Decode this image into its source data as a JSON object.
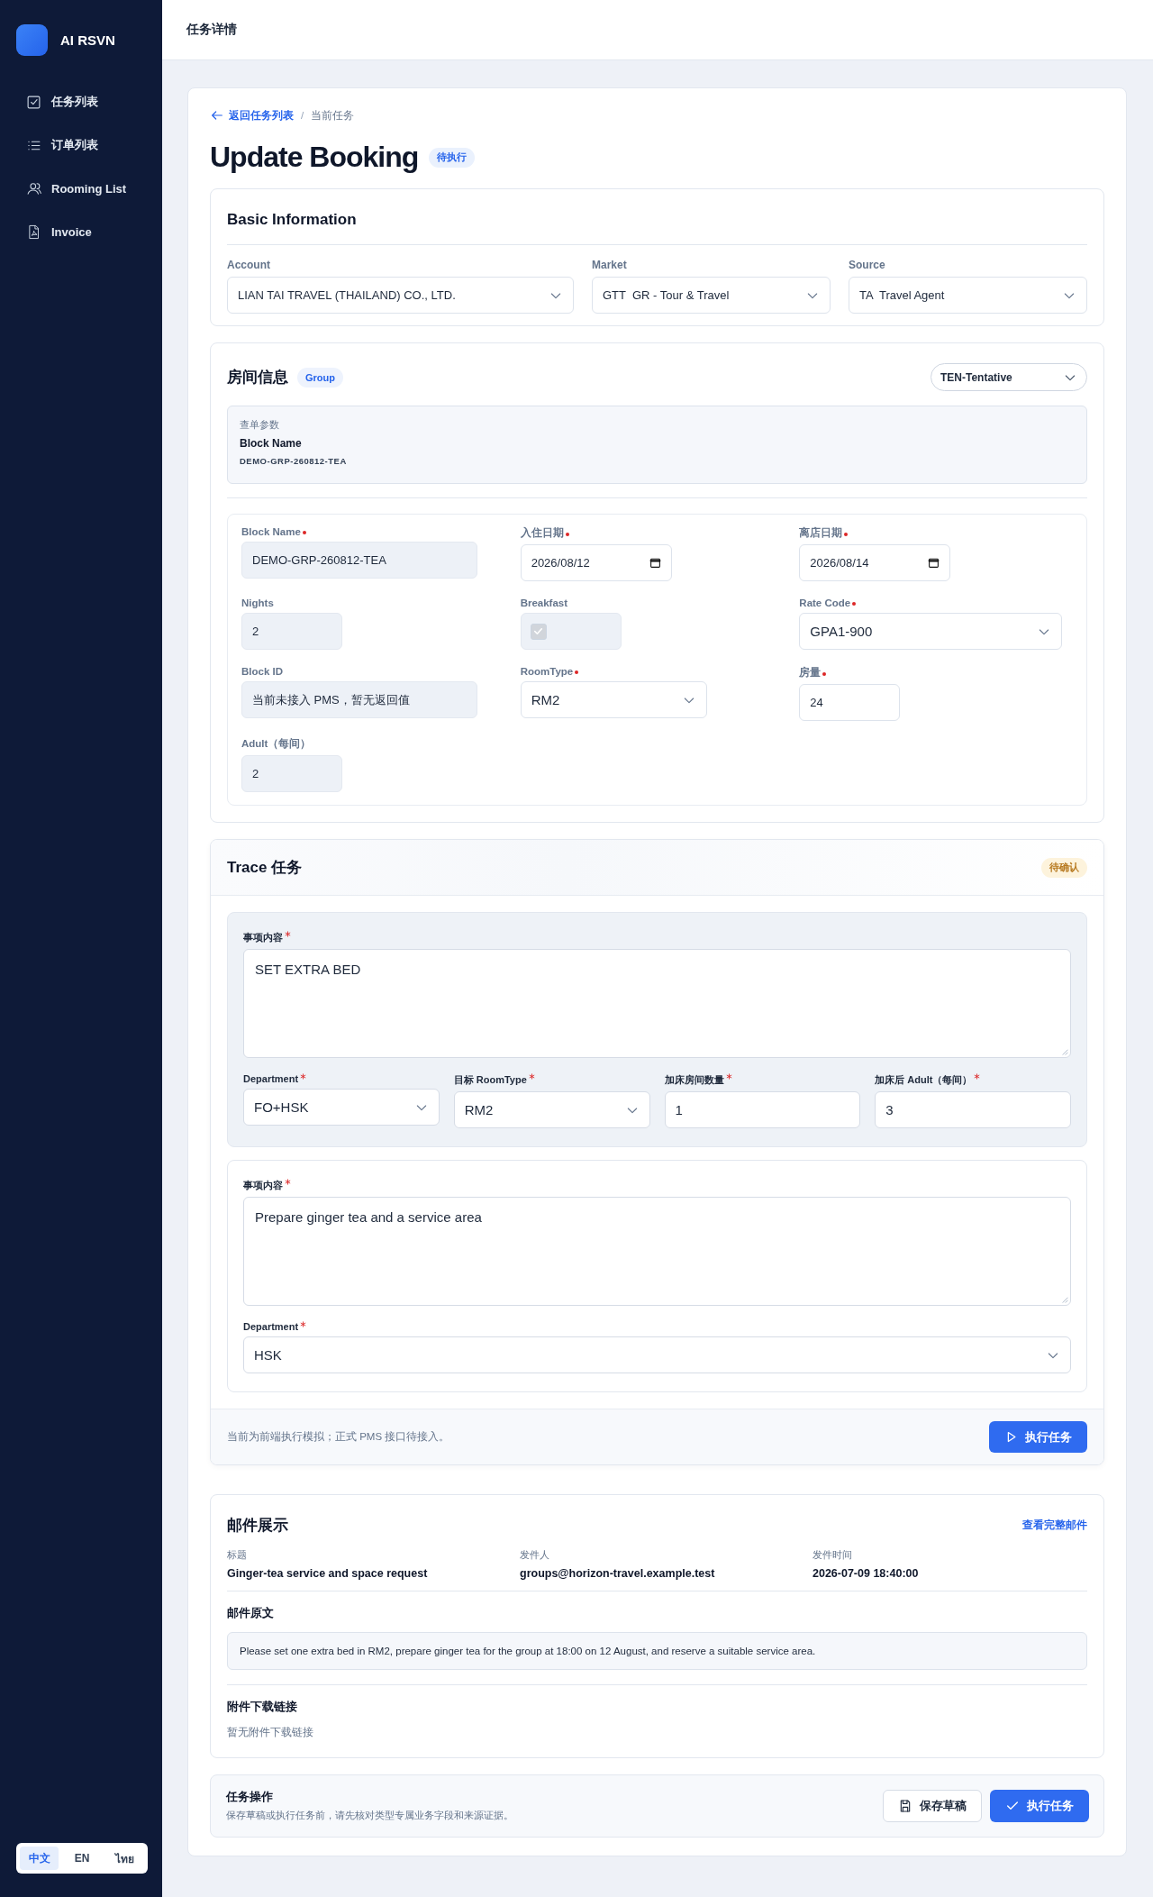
{
  "sidebar": {
    "brand": "AI RSVN",
    "items": [
      {
        "label": "任务列表"
      },
      {
        "label": "订单列表"
      },
      {
        "label": "Rooming List"
      },
      {
        "label": "Invoice"
      }
    ],
    "languages": [
      {
        "label": "中文",
        "selected": true
      },
      {
        "label": "EN",
        "selected": false
      },
      {
        "label": "ไทย",
        "selected": false
      }
    ]
  },
  "header": {
    "title": "任务详情"
  },
  "breadcrumb": {
    "back": "返回任务列表",
    "separator": "/",
    "current": "当前任务"
  },
  "page": {
    "title": "Update Booking",
    "status": "待执行"
  },
  "basic_info": {
    "title": "Basic Information",
    "fields": [
      {
        "label": "Account",
        "value": "LIAN TAI TRAVEL (THAILAND) CO., LTD."
      },
      {
        "label": "Market",
        "value": "GTT  GR - Tour & Travel"
      },
      {
        "label": "Source",
        "value": "TA  Travel Agent"
      }
    ]
  },
  "room_info": {
    "title": "房间信息",
    "badge": "Group",
    "status": "TEN-Tentative",
    "query": {
      "caption": "查单参数",
      "label": "Block Name",
      "value": "DEMO-GRP-260812-TEA"
    },
    "fields": [
      {
        "kind": "text",
        "label": "Block Name",
        "required": true,
        "readonly": true,
        "value": "DEMO-GRP-260812-TEA"
      },
      {
        "kind": "date",
        "label": "入住日期",
        "required": true,
        "readonly": false,
        "value": "2026/08/12"
      },
      {
        "kind": "date",
        "label": "离店日期",
        "required": true,
        "readonly": false,
        "value": "2026/08/14"
      },
      {
        "kind": "number",
        "label": "Nights",
        "required": false,
        "readonly": true,
        "value": "2"
      },
      {
        "kind": "checkbox",
        "label": "Breakfast",
        "required": false,
        "readonly": true,
        "checked": true
      },
      {
        "kind": "select",
        "label": "Rate Code",
        "required": true,
        "readonly": false,
        "value": "GPA1-900"
      },
      {
        "kind": "text",
        "label": "Block ID",
        "required": false,
        "readonly": true,
        "value": "当前未接入 PMS，暂无返回值"
      },
      {
        "kind": "select",
        "label": "RoomType",
        "required": true,
        "readonly": false,
        "value": "RM2"
      },
      {
        "kind": "number",
        "label": "房量",
        "required": true,
        "readonly": false,
        "value": "24"
      },
      {
        "kind": "number",
        "label": "Adult（每间）",
        "required": false,
        "readonly": true,
        "value": "2"
      }
    ]
  },
  "trace": {
    "title": "Trace 任务",
    "status": "待确认",
    "tasks": [
      {
        "active": true,
        "content_label": "事项内容",
        "content_required": true,
        "content": "SET EXTRA BED",
        "fields": [
          {
            "kind": "select",
            "label": "Department",
            "required": true,
            "value": "FO+HSK"
          },
          {
            "kind": "select",
            "label": "目标 RoomType",
            "required": true,
            "value": "RM2"
          },
          {
            "kind": "input",
            "label": "加床房间数量",
            "required": true,
            "value": "1"
          },
          {
            "kind": "input",
            "label": "加床后 Adult（每间）",
            "required": true,
            "value": "3"
          }
        ]
      },
      {
        "active": false,
        "content_label": "事项内容",
        "content_required": true,
        "content": "Prepare ginger tea and a service area",
        "fields": [
          {
            "kind": "select",
            "label": "Department",
            "required": true,
            "value": "HSK"
          }
        ]
      }
    ],
    "note": "当前为前端执行模拟；正式 PMS 接口待接入。",
    "execute_button": "执行任务"
  },
  "mail": {
    "title": "邮件展示",
    "link": "查看完整邮件",
    "meta": [
      {
        "label": "标题",
        "value": "Ginger-tea service and space request"
      },
      {
        "label": "发件人",
        "value": "groups@horizon-travel.example.test"
      },
      {
        "label": "发件时间",
        "value": "2026-07-09 18:40:00"
      }
    ],
    "body_title": "邮件原文",
    "body": "Please set one extra bed in RM2, prepare ginger tea for the group at 18:00 on 12 August, and reserve a suitable service area.",
    "attachments_title": "附件下载链接",
    "attachments_empty": "暂无附件下载链接"
  },
  "actions": {
    "title": "任务操作",
    "hint": "保存草稿或执行任务前，请先核对类型专属业务字段和来源证据。",
    "buttons": [
      {
        "kind": "secondary",
        "label": "保存草稿"
      },
      {
        "kind": "primary",
        "label": "执行任务"
      }
    ]
  }
}
